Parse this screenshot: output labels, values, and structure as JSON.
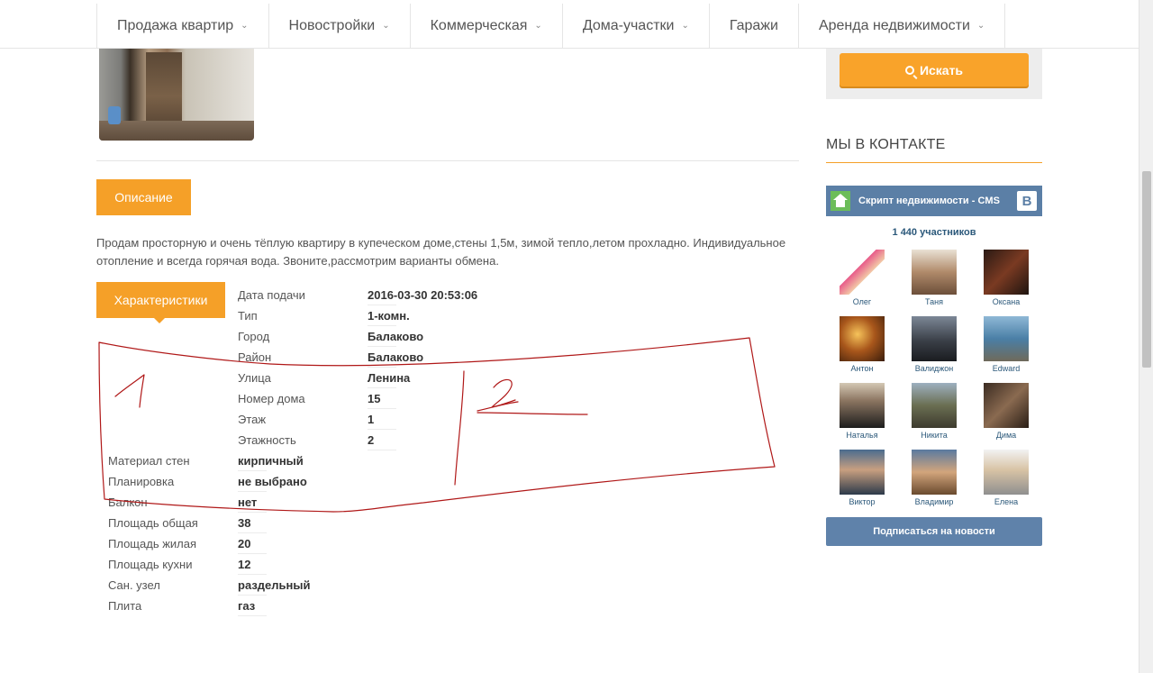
{
  "nav": {
    "items": [
      {
        "label": "Продажа квартир",
        "dropdown": true
      },
      {
        "label": "Новостройки",
        "dropdown": true
      },
      {
        "label": "Коммерческая",
        "dropdown": true
      },
      {
        "label": "Дома-участки",
        "dropdown": true
      },
      {
        "label": "Гаражи",
        "dropdown": false
      },
      {
        "label": "Аренда недвижимости",
        "dropdown": true
      }
    ]
  },
  "listing": {
    "tab_description": "Описание",
    "description": "Продам просторную и очень тёплую квартиру в купеческом доме,стены 1,5м, зимой тепло,летом прохладно. Индивидуальное отопление и всегда горячая вода. Звоните,рассмотрим варианты обмена.",
    "tab_characteristics": "Характеристики",
    "characteristics": [
      {
        "label": "Дата подачи",
        "value": "2016-03-30 20:53:06"
      },
      {
        "label": "Тип",
        "value": "1-комн."
      },
      {
        "label": "Город",
        "value": "Балаково"
      },
      {
        "label": "Район",
        "value": "Балаково"
      },
      {
        "label": "Улица",
        "value": "Ленина"
      },
      {
        "label": "Номер дома",
        "value": "15"
      },
      {
        "label": "Этаж",
        "value": "1"
      },
      {
        "label": "Этажность",
        "value": "2"
      },
      {
        "label": "Материал стен",
        "value": "кирпичный"
      },
      {
        "label": "Планировка",
        "value": "не выбрано"
      },
      {
        "label": "Балкон",
        "value": "нет"
      },
      {
        "label": "Площадь общая",
        "value": "38"
      },
      {
        "label": "Площадь жилая",
        "value": "20"
      },
      {
        "label": "Площадь кухни",
        "value": "12"
      },
      {
        "label": "Сан. узел",
        "value": "раздельный"
      },
      {
        "label": "Плита",
        "value": "газ"
      }
    ]
  },
  "sidebar": {
    "search_label": "Искать",
    "vk_heading": "МЫ В КОНТАКТЕ",
    "vk_group_name": "Скрипт недвижимости - CMS",
    "vk_logo": "В",
    "vk_count": "1 440 участников",
    "members": [
      "Олег",
      "Таня",
      "Оксана",
      "Антон",
      "Валиджон",
      "Edward",
      "Наталья",
      "Никита",
      "Дима",
      "Виктор",
      "Владимир",
      "Елена"
    ],
    "subscribe_label": "Подписаться на новости"
  },
  "annotations": {
    "mark_1": "1",
    "mark_2": "2"
  },
  "colors": {
    "accent": "#f5a028",
    "vk_blue": "#5b7fa6",
    "scribble_red": "#b01818"
  }
}
